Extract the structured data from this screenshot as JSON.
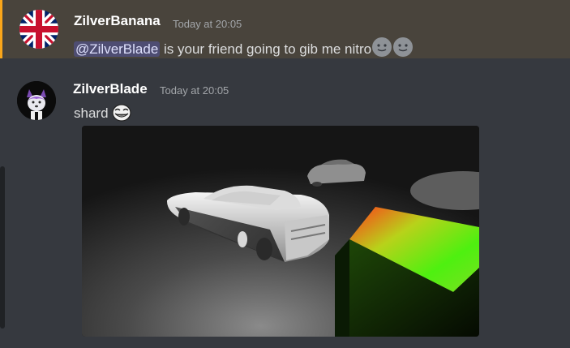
{
  "messages": [
    {
      "username": "ZilverBanana",
      "timestamp": "Today at 20:05",
      "mention": "@ZilverBlade",
      "text": " is your friend going to gib me nitro",
      "emojis": [
        "slight-smile-emoji",
        "slight-smile-emoji"
      ],
      "highlighted": true
    },
    {
      "username": "ZilverBlade",
      "timestamp": "Today at 20:05",
      "text": "shard",
      "emojis": [
        "trollface-emoji"
      ],
      "attachment": "3d-render-screenshot"
    }
  ],
  "colors": {
    "background": "#36393f",
    "highlight": "#49443c",
    "highlight_border": "#faa61a",
    "mention_bg": "#3c4270",
    "mention_text": "#dee0fc"
  }
}
